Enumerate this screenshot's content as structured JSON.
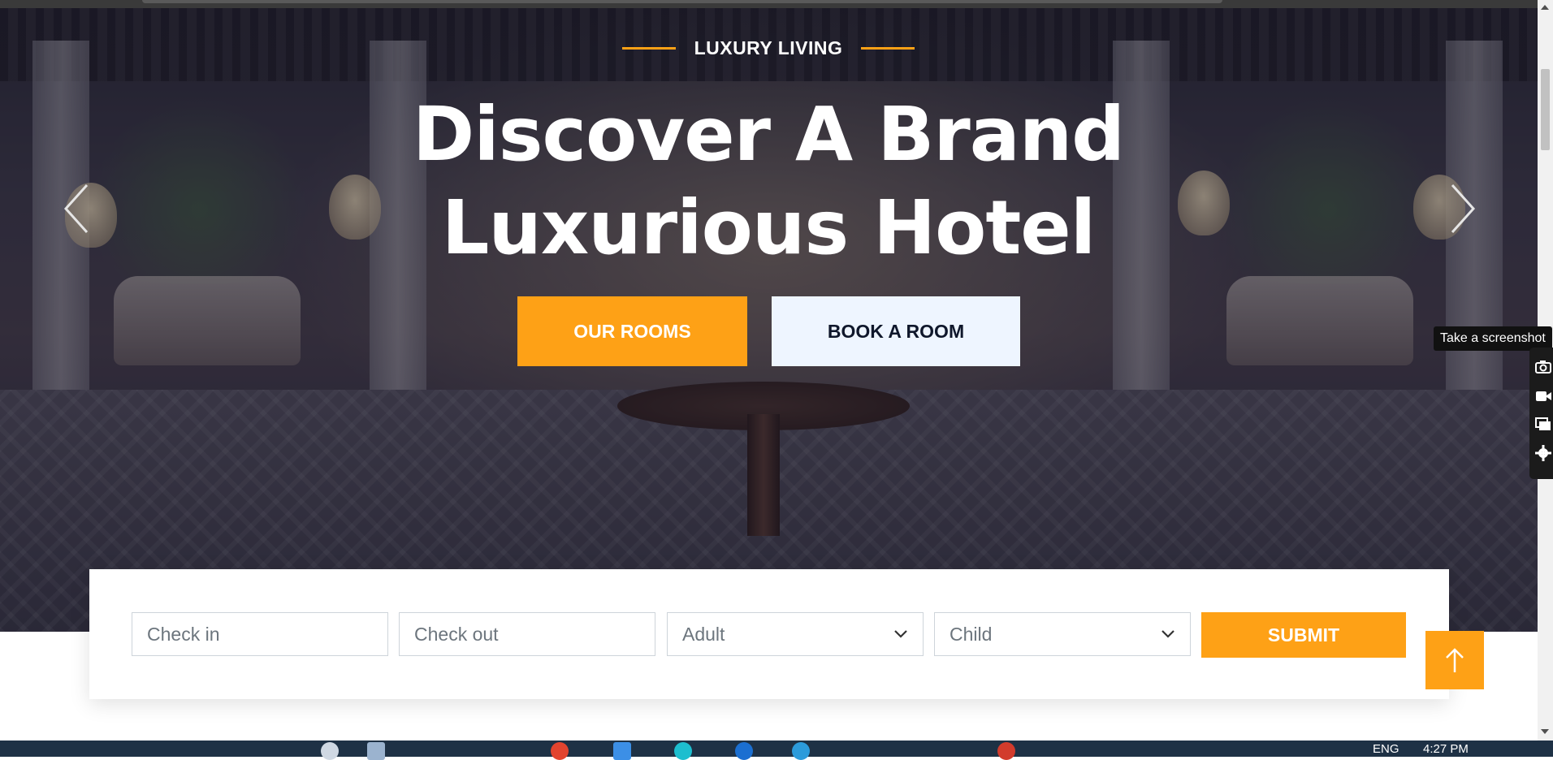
{
  "hero": {
    "subtitle": "LUXURY LIVING",
    "headline_line1": "Discover A Brand",
    "headline_line2": "Luxurious Hotel",
    "primary_button": "OUR ROOMS",
    "secondary_button": "BOOK A ROOM",
    "prev_icon": "chevron-left-icon",
    "next_icon": "chevron-right-icon"
  },
  "booking": {
    "check_in_placeholder": "Check in",
    "check_out_placeholder": "Check out",
    "adult_selected": "Adult",
    "child_selected": "Child",
    "submit_label": "SUBMIT"
  },
  "back_to_top_icon": "arrow-up-icon",
  "screenshot_tool": {
    "tooltip": "Take a screenshot",
    "icons": [
      "camera-icon",
      "video-icon",
      "window-icon",
      "gear-icon"
    ]
  },
  "taskbar": {
    "language": "ENG",
    "time": "4:27 PM"
  },
  "colors": {
    "accent": "#fea116",
    "dark": "#0f172b",
    "light_button": "#eef5ff"
  }
}
